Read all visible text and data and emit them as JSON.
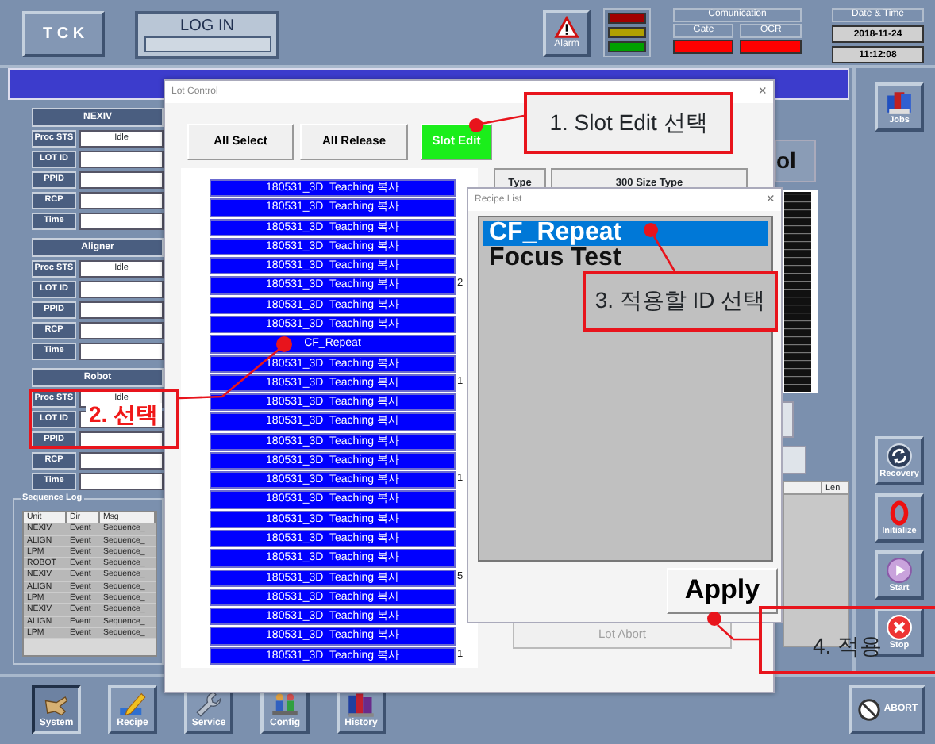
{
  "top_bar": {
    "tck": "T C K",
    "login": "LOG IN",
    "alarm": "Alarm",
    "lights": [
      {
        "color": "#a00000"
      },
      {
        "color": "#b0a000"
      },
      {
        "color": "#00a000"
      }
    ],
    "communication": {
      "title": "Comunication",
      "channels": [
        {
          "label": "Gate",
          "color": "#ff0000"
        },
        {
          "label": "OCR",
          "color": "#ff0000"
        }
      ]
    },
    "date_time": {
      "title": "Date & Time",
      "date": "2018-11-24",
      "time": "11:12:08"
    }
  },
  "status_panels": [
    {
      "title": "NEXIV",
      "rows": [
        {
          "label": "Proc STS",
          "value": "Idle"
        },
        {
          "label": "LOT ID"
        },
        {
          "label": "PPID"
        },
        {
          "label": "RCP"
        },
        {
          "label": "Time"
        }
      ]
    },
    {
      "title": "Aligner",
      "rows": [
        {
          "label": "Proc STS",
          "value": "Idle"
        },
        {
          "label": "LOT ID"
        },
        {
          "label": "PPID"
        },
        {
          "label": "RCP"
        },
        {
          "label": "Time"
        }
      ]
    },
    {
      "title": "Robot",
      "rows": [
        {
          "label": "Proc STS",
          "value": "Idle"
        },
        {
          "label": "LOT ID"
        },
        {
          "label": "PPID"
        },
        {
          "label": "RCP"
        },
        {
          "label": "Time"
        }
      ]
    }
  ],
  "sequence_log": {
    "title": "Sequence Log",
    "columns": [
      "Unit",
      "Dir",
      "Msg"
    ],
    "rows": [
      [
        "NEXIV",
        "Event",
        "Sequence_"
      ],
      [
        "ALIGN",
        "Event",
        "Sequence_"
      ],
      [
        "LPM",
        "Event",
        "Sequence_"
      ],
      [
        "ROBOT",
        "Event",
        "Sequence_"
      ],
      [
        "NEXIV",
        "Event",
        "Sequence_"
      ],
      [
        "ALIGN",
        "Event",
        "Sequence_"
      ],
      [
        "LPM",
        "Event",
        "Sequence_"
      ],
      [
        "NEXIV",
        "Event",
        "Sequence_"
      ],
      [
        "ALIGN",
        "Event",
        "Sequence_"
      ],
      [
        "LPM",
        "Event",
        "Sequence_"
      ]
    ]
  },
  "background": {
    "label": "ol",
    "table_column": "Len"
  },
  "side_buttons": [
    {
      "label": "Jobs"
    },
    {
      "label": "Recovery"
    },
    {
      "label": "Initialize"
    },
    {
      "label": "Start"
    },
    {
      "label": "Stop"
    }
  ],
  "lot_control": {
    "title": "Lot Control",
    "close": "×",
    "buttons": [
      {
        "label": "All Select",
        "active": false
      },
      {
        "label": "All Release",
        "active": false
      },
      {
        "label": "Slot Edit",
        "active": true
      }
    ],
    "slots": [
      {
        "recipe": "180531_3D  Teaching 복사"
      },
      {
        "recipe": "180531_3D  Teaching 복사"
      },
      {
        "recipe": "180531_3D  Teaching 복사"
      },
      {
        "recipe": "180531_3D  Teaching 복사"
      },
      {
        "recipe": "180531_3D  Teaching 복사"
      },
      {
        "recipe": "180531_3D  Teaching 복사",
        "number": "2"
      },
      {
        "recipe": "180531_3D  Teaching 복사"
      },
      {
        "recipe": "180531_3D  Teaching 복사"
      },
      {
        "recipe": "CF_Repeat"
      },
      {
        "recipe": "180531_3D  Teaching 복사"
      },
      {
        "recipe": "180531_3D  Teaching 복사",
        "number": "1"
      },
      {
        "recipe": "180531_3D  Teaching 복사"
      },
      {
        "recipe": "180531_3D  Teaching 복사"
      },
      {
        "recipe": "180531_3D  Teaching 복사"
      },
      {
        "recipe": "180531_3D  Teaching 복사"
      },
      {
        "recipe": "180531_3D  Teaching 복사",
        "number": "1"
      },
      {
        "recipe": "180531_3D  Teaching 복사"
      },
      {
        "recipe": "180531_3D  Teaching 복사"
      },
      {
        "recipe": "180531_3D  Teaching 복사"
      },
      {
        "recipe": "180531_3D  Teaching 복사"
      },
      {
        "recipe": "180531_3D  Teaching 복사",
        "number": "5"
      },
      {
        "recipe": "180531_3D  Teaching 복사"
      },
      {
        "recipe": "180531_3D  Teaching 복사"
      },
      {
        "recipe": "180531_3D  Teaching 복사"
      },
      {
        "recipe": "180531_3D  Teaching 복사",
        "number": "1"
      }
    ],
    "type_label": "Type",
    "type_value": "300 Size Type",
    "lot_abort": {
      "label": "Lot Abort",
      "disabled": true
    }
  },
  "recipe_list": {
    "title": "Recipe List",
    "close": "×",
    "items": [
      {
        "name": "CF_Repeat",
        "selected": true
      },
      {
        "name": "Focus Test",
        "selected": false
      }
    ],
    "apply": "Apply"
  },
  "annotations": [
    {
      "text": "1. Slot Edit 선택"
    },
    {
      "text": "2. 선택"
    },
    {
      "text": "3. 적용할 ID 선택"
    },
    {
      "text": "4. 적용"
    }
  ],
  "bottom_bar": {
    "buttons": [
      {
        "label": "System",
        "selected": true
      },
      {
        "label": "Recipe",
        "selected": false
      },
      {
        "label": "Service",
        "selected": false
      },
      {
        "label": "Config",
        "selected": false
      },
      {
        "label": "History",
        "selected": false
      }
    ],
    "abort": "ABORT"
  }
}
